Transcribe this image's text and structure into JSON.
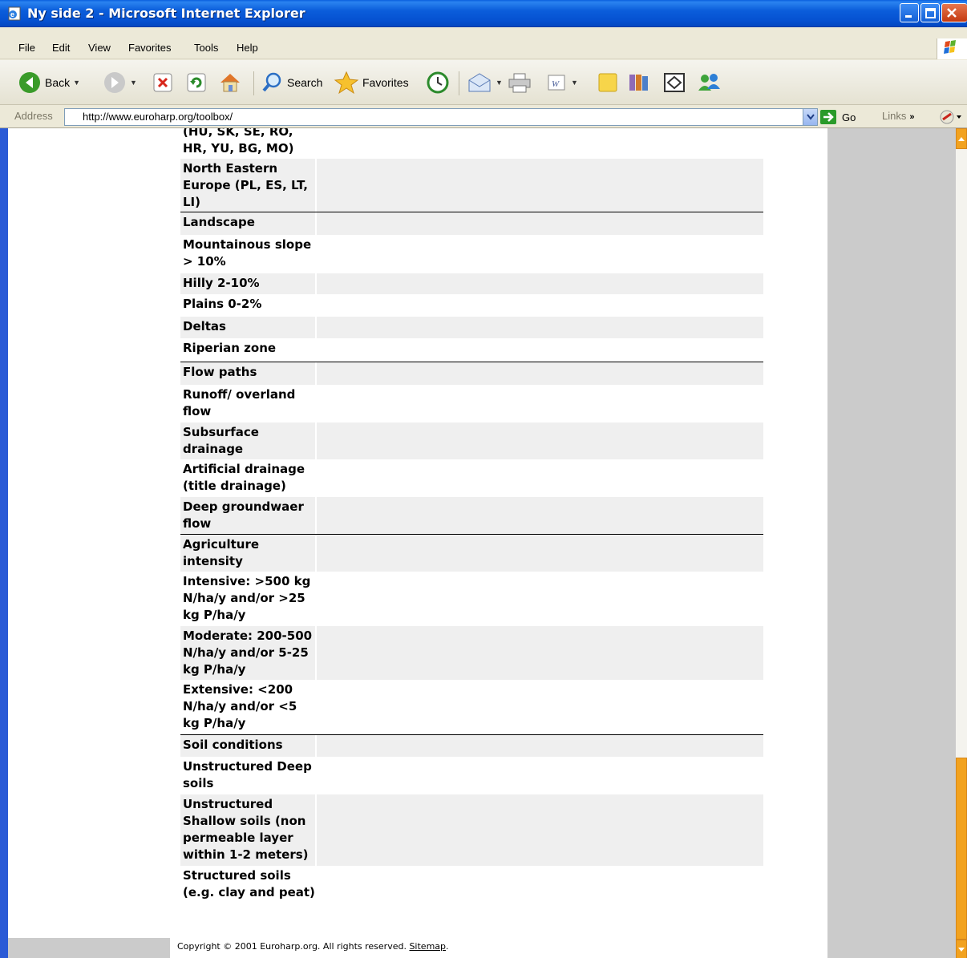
{
  "window": {
    "title": "Ny side 2 - Microsoft Internet Explorer"
  },
  "menu": [
    "File",
    "Edit",
    "View",
    "Favorites",
    "Tools",
    "Help"
  ],
  "toolbar": {
    "back": "Back",
    "search": "Search",
    "favorites": "Favorites"
  },
  "address": {
    "label": "Address",
    "url": "http://www.euroharp.org/toolbox/",
    "go": "Go",
    "links": "Links",
    "chevron": "»"
  },
  "table": {
    "rows": [
      {
        "label": "(HU, SK, SE, RO, HR, YU, BG, MO)",
        "shade": false,
        "section": false
      },
      {
        "label": "North Eastern Europe (PL, ES, LT, LI)",
        "shade": true,
        "section": false
      },
      {
        "label": "Landscape",
        "shade": true,
        "section": true
      },
      {
        "label": "Mountainous slope > 10%",
        "shade": false,
        "section": false
      },
      {
        "label": "Hilly 2-10%",
        "shade": true,
        "section": false
      },
      {
        "label": "Plains 0-2%",
        "shade": false,
        "section": false
      },
      {
        "label": "Deltas",
        "shade": true,
        "section": false
      },
      {
        "label": "Riperian zone",
        "shade": false,
        "section": false
      },
      {
        "label": "Flow paths",
        "shade": true,
        "section": true
      },
      {
        "label": "Runoff/ overland flow",
        "shade": false,
        "section": false
      },
      {
        "label": "Subsurface drainage",
        "shade": true,
        "section": false
      },
      {
        "label": "Artificial drainage (title drainage)",
        "shade": false,
        "section": false
      },
      {
        "label": "Deep groundwaer flow",
        "shade": true,
        "section": false
      },
      {
        "label": "Agriculture intensity",
        "shade": true,
        "section": true
      },
      {
        "label": "Intensive: >500 kg N/ha/y and/or >25 kg P/ha/y",
        "shade": false,
        "section": false
      },
      {
        "label": "Moderate: 200-500 N/ha/y and/or 5-25 kg P/ha/y",
        "shade": true,
        "section": false
      },
      {
        "label": "Extensive: <200 N/ha/y and/or <5 kg P/ha/y",
        "shade": false,
        "section": false
      },
      {
        "label": "Soil conditions",
        "shade": true,
        "section": true
      },
      {
        "label": "Unstructured Deep soils",
        "shade": false,
        "section": false
      },
      {
        "label": "Unstructured Shallow soils (non permeable layer within 1-2 meters)",
        "shade": true,
        "section": false
      },
      {
        "label": "Structured soils (e.g. clay and peat)",
        "shade": false,
        "section": false
      }
    ]
  },
  "footer": {
    "copyright": "Copyright © 2001 Euroharp.org. All rights reserved.",
    "sitemap": "Sitemap",
    "period": "."
  }
}
